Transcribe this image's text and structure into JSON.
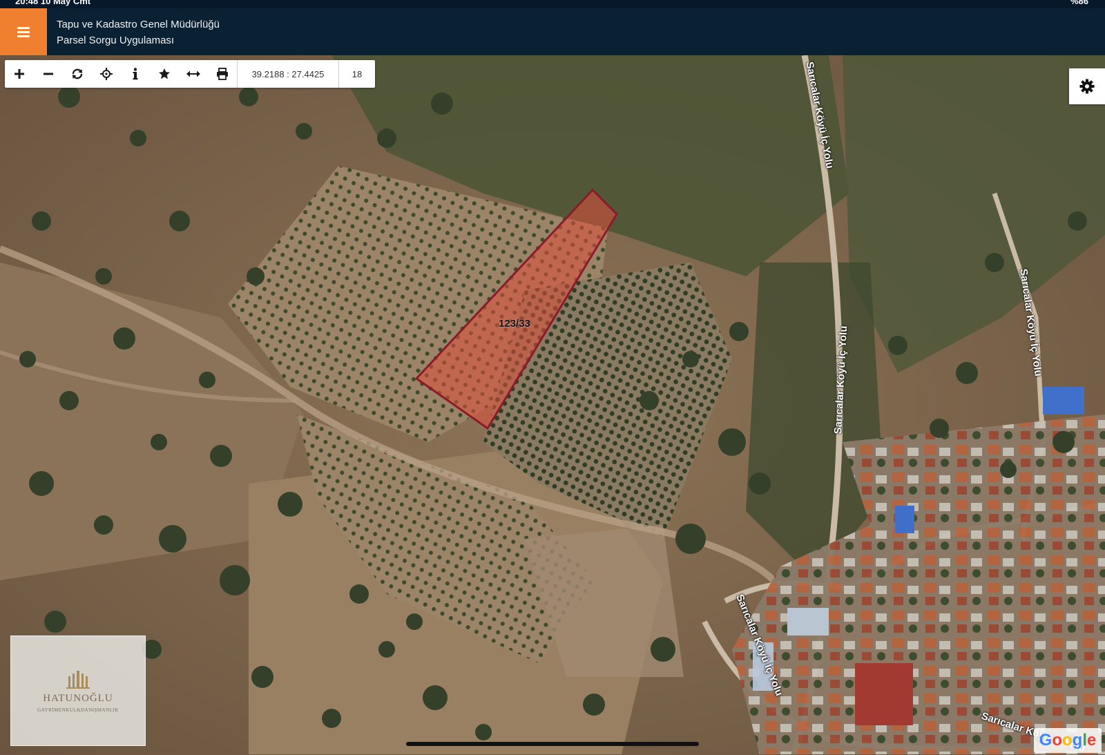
{
  "status_bar": {
    "time": "20:48",
    "date": "10 May Cmt",
    "battery": "%86"
  },
  "header": {
    "menu_icon": "hamburger-menu-icon",
    "title_line1": "Tapu ve Kadastro Genel Müdürlüğü",
    "title_line2": "Parsel Sorgu Uygulaması",
    "background_color": "#0a2133",
    "accent_color": "#f08030"
  },
  "toolbar": {
    "tools": [
      {
        "icon": "zoom-in-icon"
      },
      {
        "icon": "zoom-out-icon"
      },
      {
        "icon": "refresh-icon"
      },
      {
        "icon": "locate-icon"
      },
      {
        "icon": "info-icon"
      },
      {
        "icon": "star-icon"
      },
      {
        "icon": "measure-icon"
      },
      {
        "icon": "print-icon"
      }
    ],
    "coordinates": "39.2188 : 27.4425",
    "zoom_level": "18"
  },
  "settings": {
    "icon": "gear-icon"
  },
  "map": {
    "parcel_label": "123/33",
    "parcel_outline_color": "#8b1a2b",
    "parcel_fill_color": "#e0503c",
    "road_labels": [
      "Sarıcalar Köyü İç Yolu",
      "Sarıcalar Köyü İç Yolu",
      "Sarıcalar Köyü İç Yolu",
      "Sarıcalar Köyü İç Yolu",
      "Sarıcalar Köyü İç Yolu"
    ]
  },
  "watermark": {
    "brand": "HATUNOĞLU",
    "subtitle": "GAYRİMENKUL&DANIŞMANLIK"
  },
  "google_logo": "Google"
}
